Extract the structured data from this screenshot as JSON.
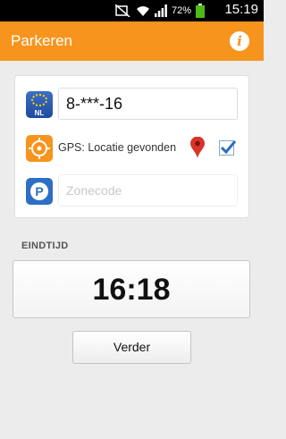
{
  "status_bar": {
    "battery_percent": "72%",
    "time": "15:19"
  },
  "app_bar": {
    "title": "Parkeren",
    "info_label": "i"
  },
  "form": {
    "plate": {
      "icon": "nl-flag-icon",
      "icon_text": "NL",
      "value": "8-***-16"
    },
    "gps": {
      "icon": "gps-crosshair-icon",
      "label": "GPS: Locatie gevonden",
      "checked": true
    },
    "zone": {
      "icon": "parking-p-icon",
      "icon_text": "P",
      "value": "",
      "placeholder": "Zonecode"
    }
  },
  "end_time": {
    "label": "EINDTIJD",
    "value": "16:18"
  },
  "actions": {
    "next_label": "Verder"
  },
  "colors": {
    "accent": "#f7941d",
    "status_bar": "#000000",
    "background": "#ececec"
  }
}
